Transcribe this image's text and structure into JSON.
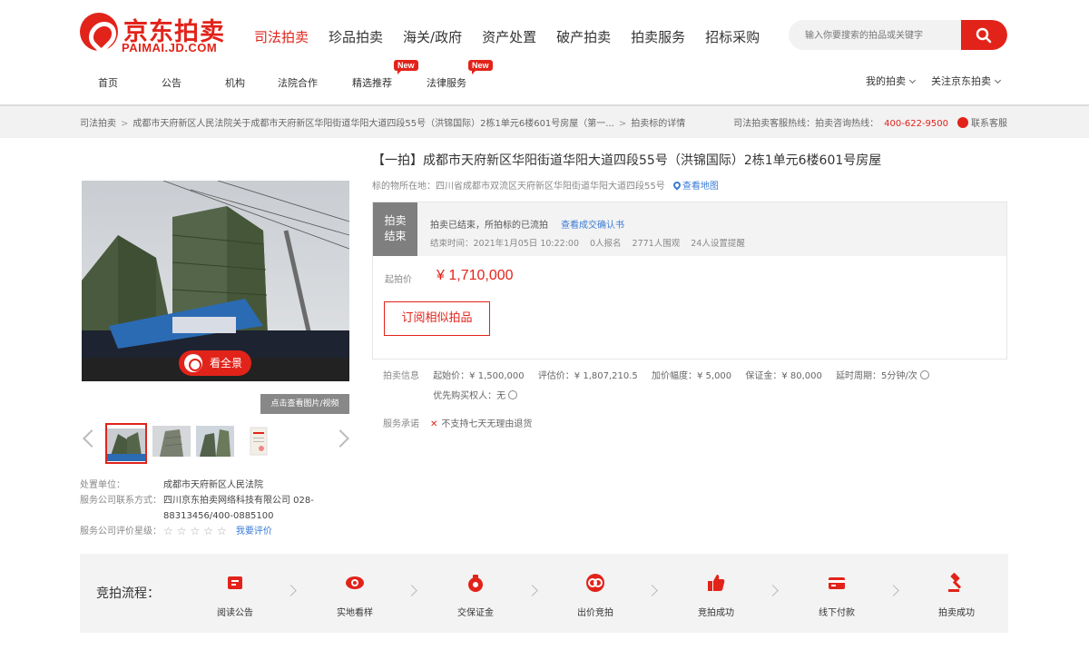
{
  "header": {
    "logo_cn": "京东拍卖",
    "logo_en": "PAIMAI.JD.COM",
    "main_nav": [
      "司法拍卖",
      "珍品拍卖",
      "海关/政府",
      "资产处置",
      "破产拍卖",
      "拍卖服务",
      "招标采购"
    ],
    "active_main": 0,
    "search_placeholder": "输入你要搜索的拍品或关键字",
    "sub_nav": [
      {
        "label": "首页",
        "new": false
      },
      {
        "label": "公告",
        "new": false
      },
      {
        "label": "机构",
        "new": false
      },
      {
        "label": "法院合作",
        "new": false
      },
      {
        "label": "精选推荐",
        "new": true
      },
      {
        "label": "法律服务",
        "new": true
      }
    ],
    "new_badge": "New",
    "user_nav": [
      "我的拍卖",
      "关注京东拍卖"
    ]
  },
  "breadcrumb": {
    "items": [
      "司法拍卖",
      "成都市天府新区人民法院关于成都市天府新区华阳街道华阳大道四段55号（洪锦国际）2栋1单元6楼601号房屋（第一...",
      "拍卖标的详情"
    ],
    "right_text": "司法拍卖客服热线：拍卖咨询热线：",
    "phone": "400-622-9500",
    "service": "联系客服"
  },
  "gallery": {
    "vr_label": "看全景",
    "caption": "点击查看图片/视频",
    "thumb_count": 4
  },
  "org": {
    "rows": [
      {
        "k": "处置单位：",
        "v": "成都市天府新区人民法院"
      },
      {
        "k": "服务公司联系方式：",
        "v": "四川京东拍卖网络科技有限公司 028-"
      },
      {
        "k": "",
        "v": "88313456/400-0885100"
      },
      {
        "k": "服务公司评价星级：",
        "v": ""
      }
    ],
    "rate_link": "我要评价",
    "stars": [
      "☆",
      "☆",
      "☆",
      "☆",
      "☆"
    ]
  },
  "item": {
    "title": "【一拍】成都市天府新区华阳街道华阳大道四段55号（洪锦国际）2栋1单元6楼601号房屋",
    "address_label": "标的物所在地：",
    "address": "四川省成都市双流区天府新区华阳街道华阳大道四段55号",
    "map_link": "查看地图"
  },
  "status": {
    "ended_line1": "拍卖",
    "ended_line2": "结束",
    "line1": "拍卖已结束，所拍标的已流拍",
    "line1_link": "查看成交确认书",
    "end_time": "结束时间：2021年1月05日 10:22:00",
    "bids": "0人报名",
    "watchers": "2771人围观",
    "reminders": "24人设置提醒",
    "price_label": "起拍价",
    "price": "¥ 1,710,000",
    "subscribe": "订阅相似拍品"
  },
  "auction": {
    "label": "拍卖信息",
    "items": [
      "起始价：¥ 1,500,000",
      "评估价：¥ 1,807,210.5",
      "加价幅度：¥ 5,000",
      "保证金：¥ 80,000",
      "延时周期：5分钟/次"
    ],
    "buyer": "优先购买权人：无"
  },
  "notice": {
    "label": "服务承诺",
    "text": "不支持七天无理由退货"
  },
  "process": {
    "label": "竞拍流程：",
    "steps": [
      "阅读公告",
      "实地看样",
      "交保证金",
      "出价竞拍",
      "竞拍成功",
      "线下付款",
      "拍卖成功"
    ]
  },
  "colors": {
    "brand": "#e2231a",
    "link": "#3a7bd5"
  }
}
